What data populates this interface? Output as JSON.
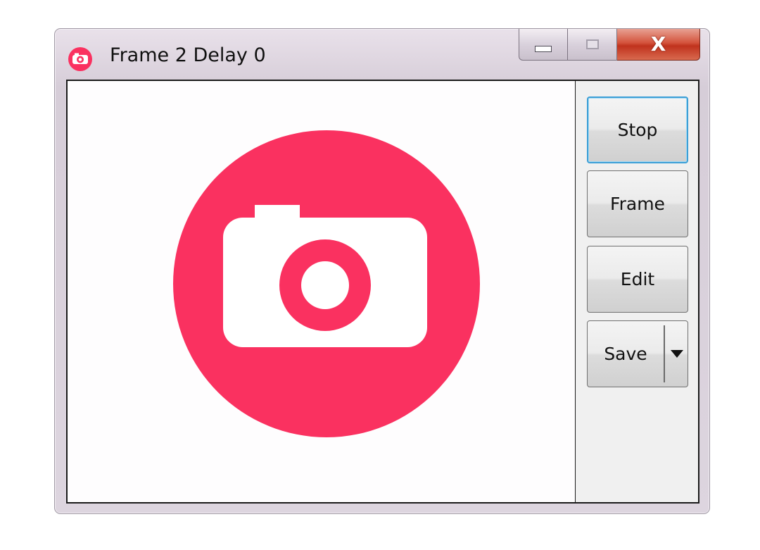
{
  "window": {
    "title": "Frame 2 Delay 0",
    "app_icon": "camera-icon",
    "caption_buttons": {
      "minimize_icon": "minimize-icon",
      "maximize_icon": "maximize-icon",
      "close_label": "X"
    }
  },
  "preview": {
    "icon": "camera-icon",
    "accent_color": "#fa3160"
  },
  "toolbar": {
    "stop_label": "Stop",
    "frame_label": "Frame",
    "edit_label": "Edit",
    "save_label": "Save",
    "save_dropdown_icon": "triangle-down-icon"
  }
}
